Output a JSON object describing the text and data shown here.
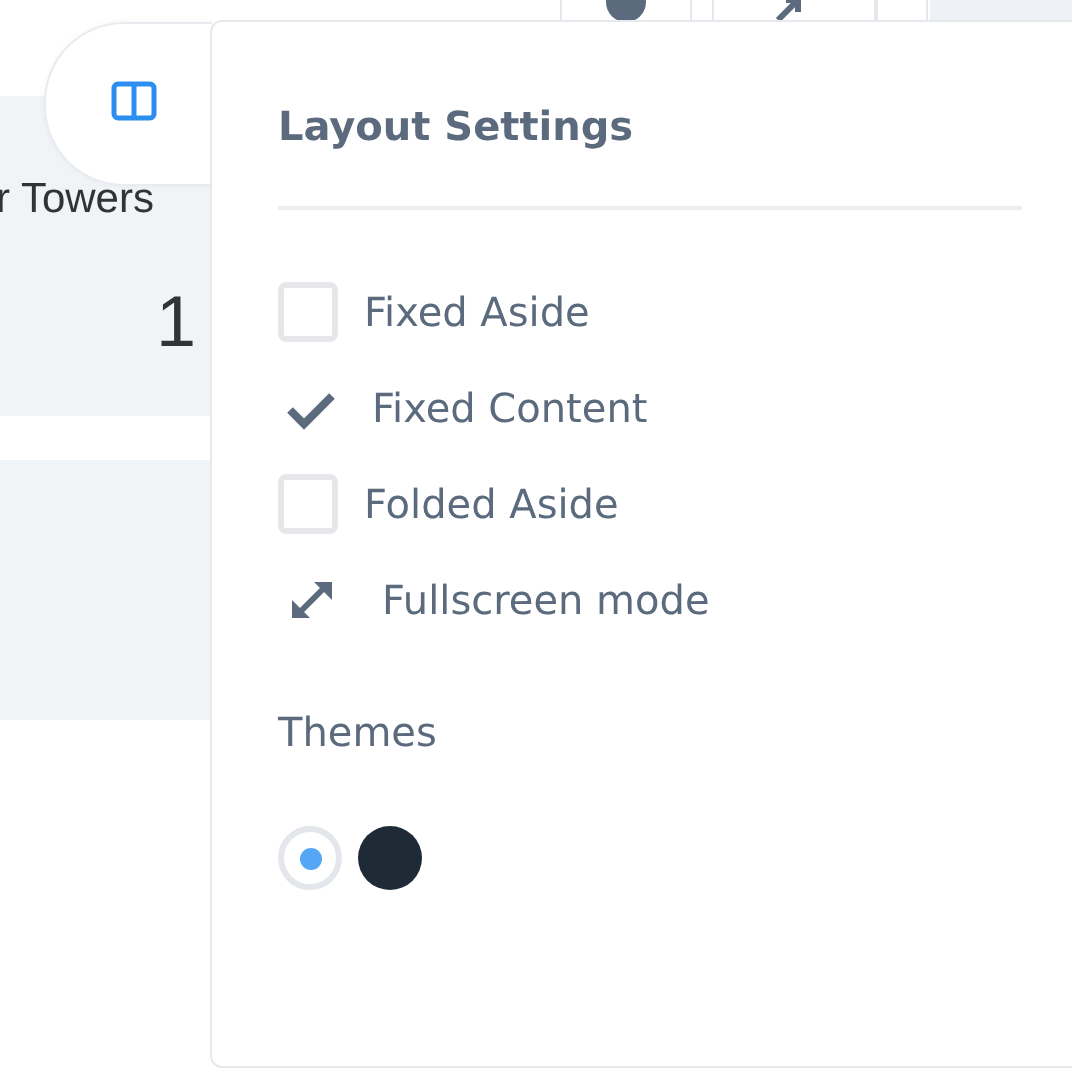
{
  "background": {
    "card_title": "r Towers",
    "card_value": "1"
  },
  "panel": {
    "title": "Layout Settings",
    "options": [
      {
        "kind": "checkbox",
        "label": "Fixed Aside",
        "checked": false
      },
      {
        "kind": "checkbox",
        "label": "Fixed Content",
        "checked": true
      },
      {
        "kind": "checkbox",
        "label": "Folded Aside",
        "checked": false
      },
      {
        "kind": "action",
        "label": "Fullscreen mode"
      }
    ],
    "themes_label": "Themes",
    "themes": [
      {
        "color": "#ffffff",
        "selected": true
      },
      {
        "color": "#1f2a37",
        "selected": false
      }
    ]
  }
}
